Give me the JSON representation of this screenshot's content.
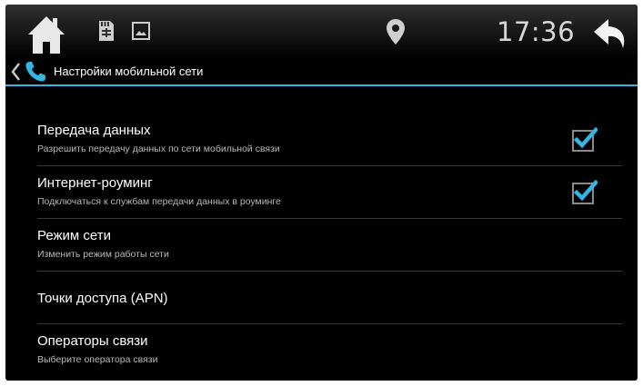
{
  "statusbar": {
    "clock": "17:36",
    "icons": [
      "home-icon",
      "sd-card-icon",
      "gallery-icon",
      "location-icon",
      "back-icon"
    ]
  },
  "actionbar": {
    "title": "Настройки мобильной сети",
    "icon": "phone-icon",
    "accent": "#33b5e5"
  },
  "settings": [
    {
      "title": "Передача данных",
      "summary": "Разрешить передачу данных по сети мобильной связи",
      "checked": true
    },
    {
      "title": "Интернет-роуминг",
      "summary": "Подключаться к службам передачи данных в роуминге",
      "checked": true
    },
    {
      "title": "Режим сети",
      "summary": "Изменить режим работы сети"
    },
    {
      "title": "Точки доступа (APN)",
      "summary": ""
    },
    {
      "title": "Операторы связи",
      "summary": "Выберите оператора связи"
    }
  ]
}
